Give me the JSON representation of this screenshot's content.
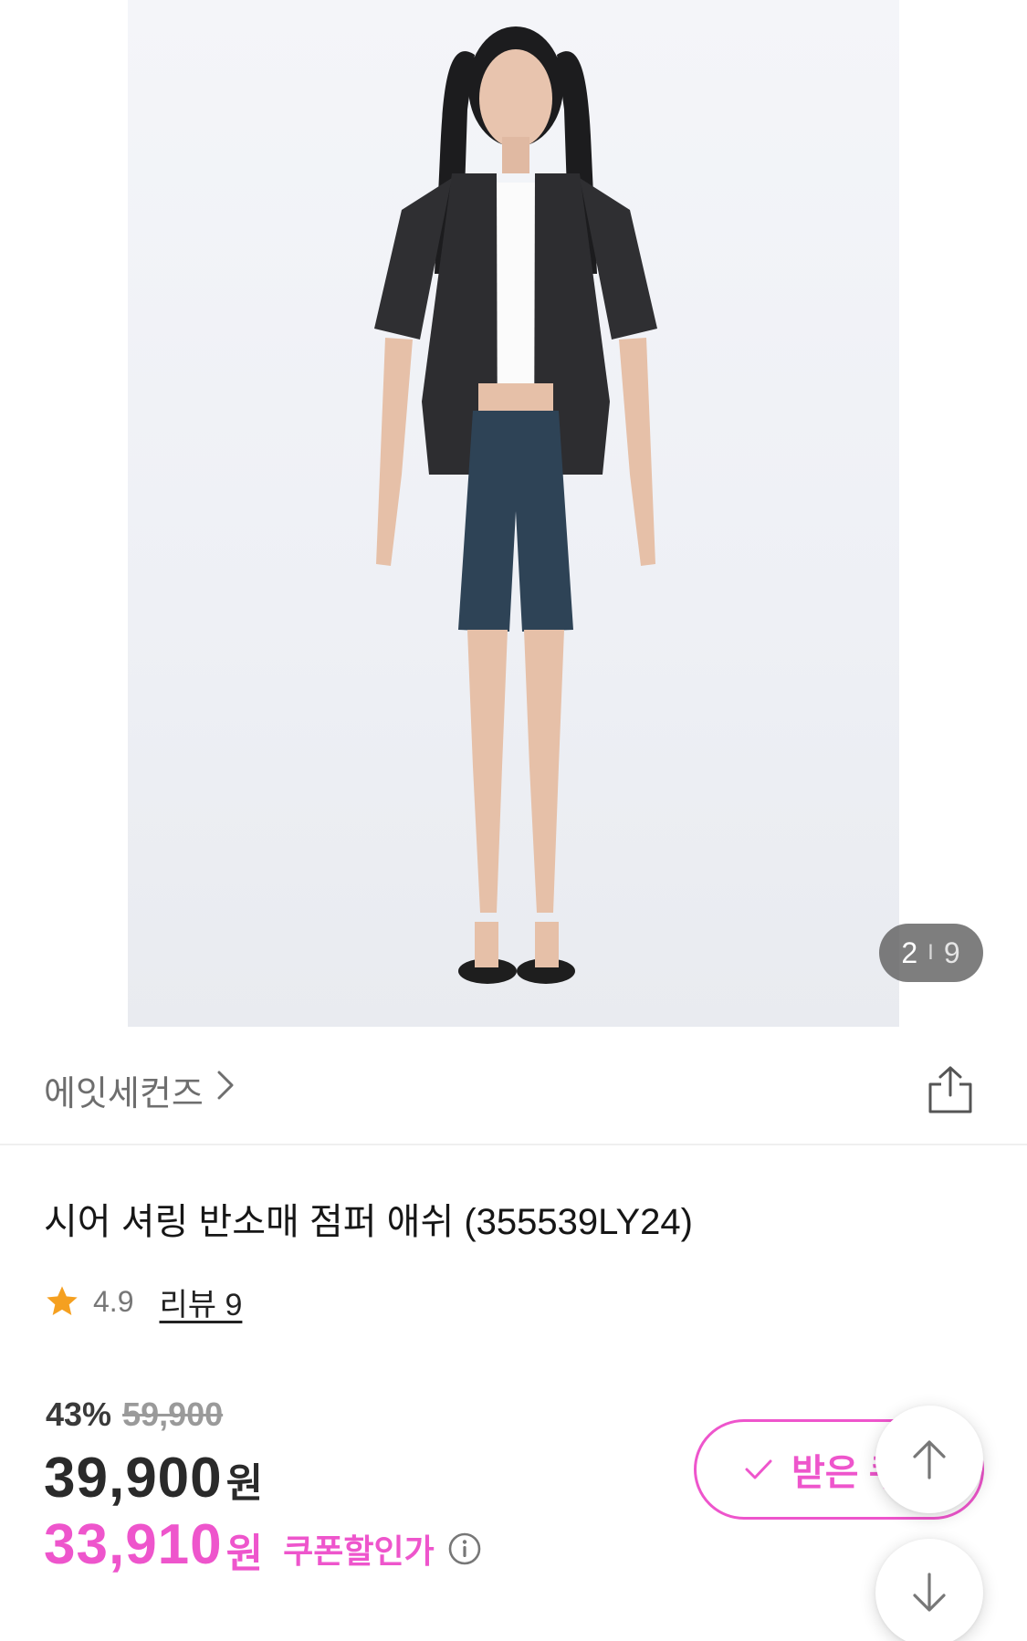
{
  "gallery": {
    "current": "2",
    "separator": "I",
    "total": "9"
  },
  "brand": {
    "name": "에잇세컨즈"
  },
  "product": {
    "title": "시어 셔링 반소매 점퍼  애쉬 (355539LY24)",
    "rating": "4.9",
    "review_label": "리뷰 9"
  },
  "price": {
    "discount_rate": "43%",
    "original": "59,900",
    "sale": "39,900",
    "sale_unit": "원",
    "coupon_price": "33,910",
    "coupon_unit": "원",
    "coupon_label": "쿠폰할인가"
  },
  "coupon_button": {
    "label": "받은 쿠"
  },
  "colors": {
    "accent": "#ee55cc",
    "star": "#f5a020",
    "counter_bg": "#5a5a5a"
  },
  "icons": {
    "share": "share-icon",
    "chevron": "chevron-right-icon",
    "star": "star-icon",
    "info": "info-icon",
    "check": "check-icon",
    "up": "arrow-up-icon",
    "down": "arrow-down-icon"
  }
}
